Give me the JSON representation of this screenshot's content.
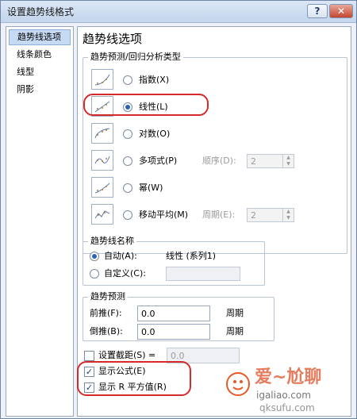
{
  "window": {
    "title": "设置趋势线格式",
    "help": "?",
    "close": "✕"
  },
  "nav": {
    "items": [
      {
        "label": "趋势线选项",
        "selected": true
      },
      {
        "label": "线条颜色",
        "selected": false
      },
      {
        "label": "线型",
        "selected": false
      },
      {
        "label": "阴影",
        "selected": false
      }
    ]
  },
  "main": {
    "heading": "趋势线选项"
  },
  "type_group": {
    "label": "趋势预测/回归分析类型",
    "options": [
      {
        "label": "指数(X)",
        "checked": false
      },
      {
        "label": "线性(L)",
        "checked": true
      },
      {
        "label": "对数(O)",
        "checked": false
      },
      {
        "label": "多项式(P)",
        "checked": false
      },
      {
        "label": "幂(W)",
        "checked": false
      },
      {
        "label": "移动平均(M)",
        "checked": false
      }
    ],
    "order_label": "顺序(D):",
    "order_value": "2",
    "period_label": "周期(E):",
    "period_value": "2"
  },
  "name_group": {
    "label": "趋势线名称",
    "auto_label": "自动(A):",
    "auto_value": "线性 (系列1)",
    "custom_label": "自定义(C):"
  },
  "forecast_group": {
    "label": "趋势预测",
    "forward_label": "前推(F):",
    "forward_value": "0.0",
    "forward_unit": "周期",
    "backward_label": "倒推(B):",
    "backward_value": "0.0",
    "backward_unit": "周期"
  },
  "intercept": {
    "label": "设置截距(S) =",
    "value": "0.0"
  },
  "display_equation": {
    "label": "显示公式(E)",
    "checked": true
  },
  "display_r2": {
    "label": "显示 R 平方值(R)",
    "checked": true
  },
  "watermark": {
    "brand": "爱~尬聊",
    "site1": "igaliao.com",
    "site2": "qksufu.com"
  },
  "colors": {
    "highlight": "#d42a2a",
    "selection": "#c7daf3",
    "accent": "#2b62b8"
  }
}
